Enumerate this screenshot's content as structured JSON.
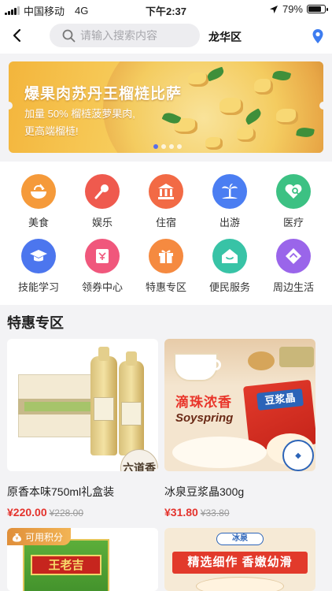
{
  "status": {
    "carrier": "中国移动",
    "network": "4G",
    "time": "下午2:37",
    "battery": "79%",
    "battery_level": 0.79
  },
  "nav": {
    "search_placeholder": "请输入搜索内容",
    "city": "龙华区"
  },
  "banner": {
    "title": "爆果肉苏丹王榴梿比萨",
    "line1": "加量 50% 榴梿菠萝果肉,",
    "line2": "更高端榴梿!",
    "slides": 4,
    "active_slide": 1
  },
  "categories": [
    {
      "label": "美食",
      "icon": "bowl-icon",
      "color": "#f59a3a"
    },
    {
      "label": "娱乐",
      "icon": "microphone-icon",
      "color": "#ef5a4e"
    },
    {
      "label": "住宿",
      "icon": "building-icon",
      "color": "#f26a45"
    },
    {
      "label": "出游",
      "icon": "palm-tree-icon",
      "color": "#4b7ef2"
    },
    {
      "label": "医疗",
      "icon": "medical-icon",
      "color": "#3cc183"
    },
    {
      "label": "技能学习",
      "icon": "graduation-cap-icon",
      "color": "#4c76ee"
    },
    {
      "label": "领券中心",
      "icon": "coupon-icon",
      "color": "#f0577c"
    },
    {
      "label": "特惠专区",
      "icon": "gift-icon",
      "color": "#f58a40"
    },
    {
      "label": "便民服务",
      "icon": "house-icon",
      "color": "#38c3a6"
    },
    {
      "label": "周边生活",
      "icon": "map-sign-icon",
      "color": "#9a65ea"
    }
  ],
  "section": {
    "title": "特惠专区"
  },
  "products": [
    {
      "name": "原香本味750ml礼盒装",
      "price": "¥220.00",
      "old_price": "¥228.00",
      "seal": "六道香"
    },
    {
      "name": "冰泉豆浆晶300g",
      "price": "¥31.80",
      "old_price": "¥33.80",
      "brand": "Soyspring",
      "slogan": "滴珠浓香",
      "pack_label": "豆浆晶"
    },
    {
      "badge": "可用积分",
      "pack_label": "王老吉"
    },
    {
      "brand_mark": "冰泉",
      "slogan": "精选细作 香嫩幼滑"
    }
  ]
}
